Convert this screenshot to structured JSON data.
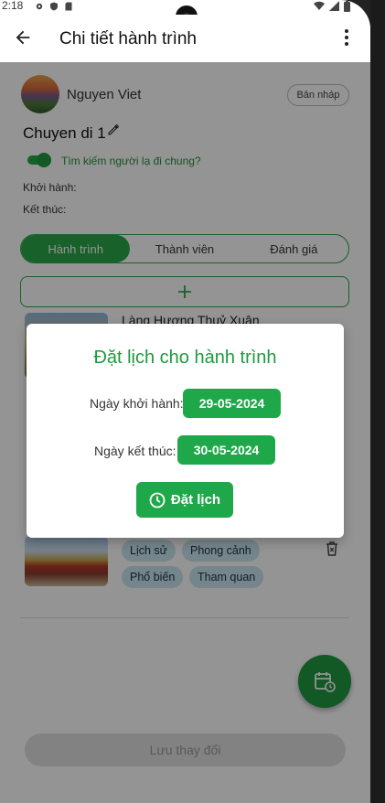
{
  "status_bar": {
    "time": "2:18"
  },
  "app_bar": {
    "title": "Chi tiết hành trình"
  },
  "profile": {
    "name": "Nguyen Viet",
    "draft_label": "Bản nháp"
  },
  "trip": {
    "name": "Chuyen di 1",
    "find_companion_label": "Tìm kiếm người lạ đi chung?",
    "start_label": "Khởi hành:",
    "end_label": "Kết thúc:"
  },
  "tabs": [
    {
      "label": "Hành trình",
      "active": true
    },
    {
      "label": "Thành viên",
      "active": false
    },
    {
      "label": "Đánh giá",
      "active": false
    }
  ],
  "places": [
    {
      "name": "Làng Hương Thuỷ Xuân"
    },
    {
      "tags": [
        "Lịch sử",
        "Phong cảnh",
        "Phổ biến",
        "Tham quan"
      ]
    }
  ],
  "save_button": {
    "label": "Lưu thay đổi"
  },
  "dialog": {
    "title": "Đặt lịch cho hành trình",
    "start_label": "Ngày khởi hành:",
    "start_date": "29-05-2024",
    "end_label": "Ngày kết thúc:",
    "end_date": "30-05-2024",
    "schedule_label": "Đặt lịch"
  },
  "colors": {
    "accent": "#1fa84a",
    "tag_background": "#c9e5f0",
    "scrim": "rgba(0,0,0,0.42)"
  },
  "icons": {
    "back": "arrow-left-icon",
    "more": "more-vertical-icon",
    "edit": "pencil-icon",
    "add": "plus-icon",
    "delete": "trash-icon",
    "fab": "calendar-clock-icon",
    "schedule": "clock-icon"
  }
}
